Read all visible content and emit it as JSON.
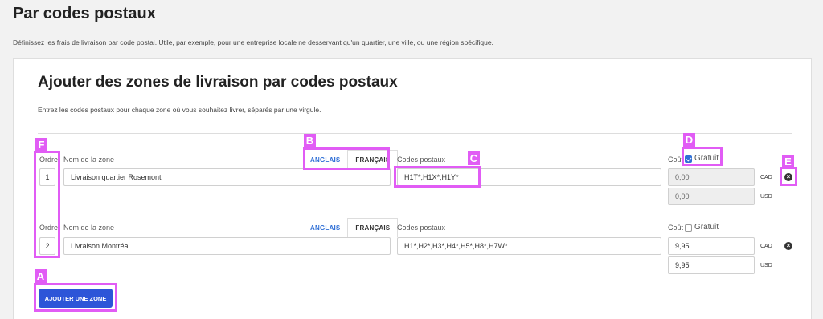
{
  "page": {
    "title": "Par codes postaux",
    "description": "Définissez les frais de livraison par code postal. Utile, par exemple, pour une entreprise locale ne desservant qu'un quartier, une ville, ou une région spécifique."
  },
  "card": {
    "title": "Ajouter des zones de livraison par codes postaux",
    "description": "Entrez les codes postaux pour chaque zone où vous souhaitez livrer, séparés par une virgule."
  },
  "labels": {
    "order": "Ordre",
    "zone_name": "Nom de la zone",
    "postal_codes": "Codes postaux",
    "cost": "Coût",
    "free": "Gratuit",
    "tab_en": "ANGLAIS",
    "tab_fr": "FRANÇAIS",
    "cad": "CAD",
    "usd": "USD"
  },
  "zones": [
    {
      "order": "1",
      "name": "Livraison quartier Rosemont",
      "codes": "H1T*,H1X*,H1Y*",
      "free": true,
      "cost_cad": "0,00",
      "cost_usd": "0,00"
    },
    {
      "order": "2",
      "name": "Livraison Montréal",
      "codes": "H1*,H2*,H3*,H4*,H5*,H8*,H7W*",
      "free": false,
      "cost_cad": "9,95",
      "cost_usd": "9,95"
    }
  ],
  "add_button": "AJOUTER UNE ZONE",
  "annotations": [
    "A",
    "B",
    "C",
    "D",
    "E",
    "F"
  ],
  "colors": {
    "highlight": "#e15cf5",
    "primary": "#2d55d8",
    "link": "#2f6fd6"
  }
}
